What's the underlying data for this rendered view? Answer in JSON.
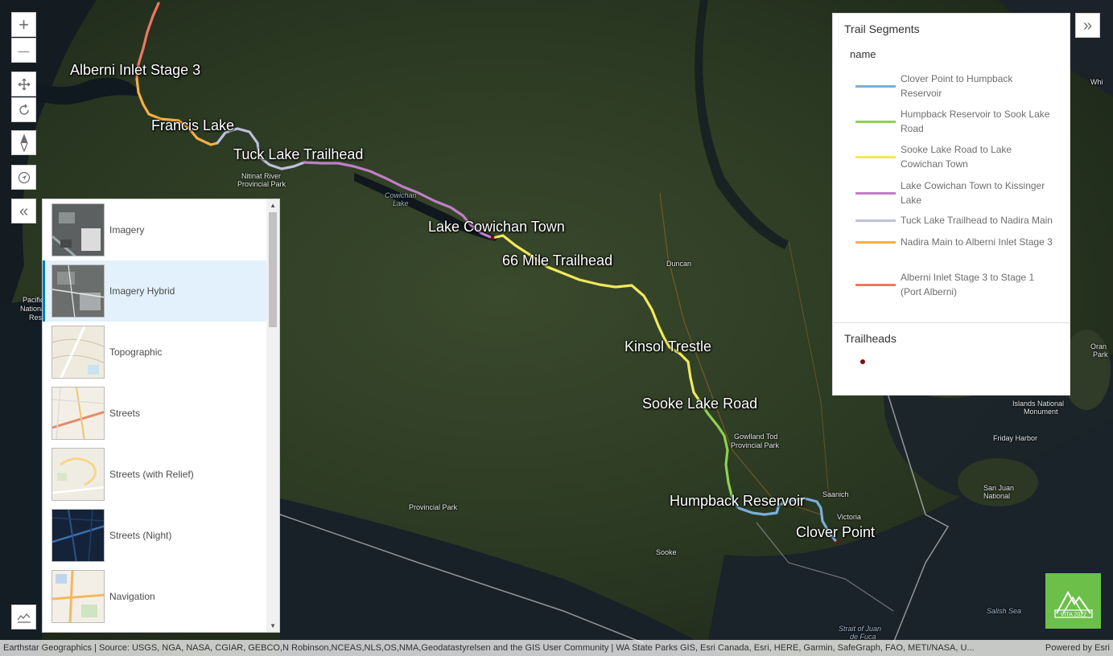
{
  "map": {
    "trail_labels": [
      "Alberni Inlet Stage 3",
      "Francis Lake",
      "Tuck Lake Trailhead",
      "Lake Cowichan Town",
      "66 Mile Trailhead",
      "Kinsol Trestle",
      "Sooke Lake Road",
      "Humpback Reservoir",
      "Clover Point"
    ],
    "place_labels": [
      "Nitinat River",
      "Provincial Park",
      "Cowichan",
      "Lake",
      "Duncan",
      "Gowlland Tod",
      "Provincial Park",
      "Provincial Park",
      "Saanich",
      "Victoria",
      "Sooke",
      "Friday Harbor",
      "San Juan",
      "National",
      "Islands National",
      "Monument",
      "Salish Sea",
      "Strait of Juan",
      "de Fuca",
      "Pacific",
      "National",
      "Res",
      "Whi",
      "Oran",
      "Park"
    ]
  },
  "controls": {
    "zoom_in": "+",
    "zoom_out": "—",
    "collapse_gallery": "«",
    "expand_legend": "»"
  },
  "gallery": {
    "items": [
      {
        "label": "Imagery"
      },
      {
        "label": "Imagery Hybrid"
      },
      {
        "label": "Topographic"
      },
      {
        "label": "Streets"
      },
      {
        "label": "Streets (with Relief)"
      },
      {
        "label": "Streets (Night)"
      },
      {
        "label": "Navigation"
      }
    ],
    "selected": "Imagery Hybrid"
  },
  "legend": {
    "title": "Trail Segments",
    "field": "name",
    "items": [
      {
        "label": "Clover Point to Humpback Reservoir",
        "color": "#7aafd9"
      },
      {
        "label": "Humpback Reservoir to Sook Lake Road",
        "color": "#8fd14f"
      },
      {
        "label": "Sooke Lake Road to Lake Cowichan Town",
        "color": "#f2e85c"
      },
      {
        "label": "Lake Cowichan Town to Kissinger Lake",
        "color": "#c07ec7"
      },
      {
        "label": "Tuck Lake Trailhead to Nadira Main",
        "color": "#bfbfdc"
      },
      {
        "label": "Nadira Main to Alberni Inlet Stage 3",
        "color": "#f5b041"
      },
      {
        "label": "Alberni Inlet Stage 3 to Stage 1 (Port Alberni)",
        "color": "#f0765f"
      }
    ],
    "trailheads_title": "Trailheads",
    "trailhead_color": "#7a1010"
  },
  "attribution": {
    "text": "Earthstar Geographics | Source: USGS, NGA, NASA, CGIAR, GEBCO,N Robinson,NCEAS,NLS,OS,NMA,Geodatastyrelsen and the GIS User Community | WA State Parks GIS, Esri Canada, Esri, HERE, Garmin, SafeGraph, FAO, METI/NASA, U...",
    "powered": "Powered by Esri"
  },
  "logo": {
    "text": "VITA 2022"
  }
}
